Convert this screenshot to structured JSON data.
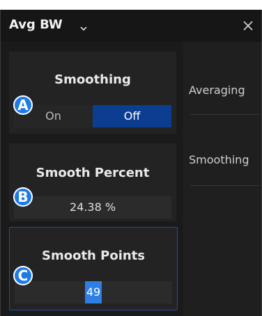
{
  "window": {
    "title": "Avg BW"
  },
  "panels": {
    "smoothing": {
      "title": "Smoothing",
      "on_label": "On",
      "off_label": "Off",
      "selected": "Off"
    },
    "smooth_percent": {
      "title": "Smooth Percent",
      "value": "24.38 %"
    },
    "smooth_points": {
      "title": "Smooth Points",
      "value": "49"
    }
  },
  "right_menu": {
    "items": [
      {
        "label": "Averaging"
      },
      {
        "label": "Smoothing"
      }
    ]
  },
  "badges": [
    "A",
    "B",
    "C"
  ],
  "colors": {
    "accent": "#0b3d91",
    "badge": "#1e7be6",
    "panel_bg": "#232323",
    "text": "#eaeaea"
  },
  "icons": {
    "dropdown": "chevron-down-icon",
    "close": "close-icon"
  }
}
